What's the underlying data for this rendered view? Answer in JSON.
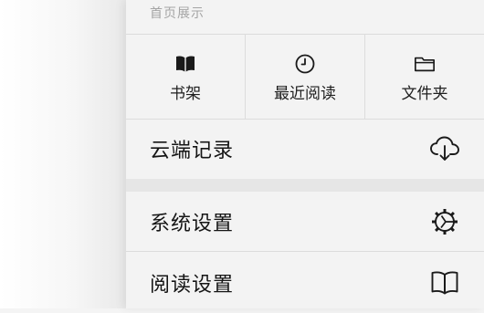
{
  "section": {
    "title": "首页展示"
  },
  "quick_access": [
    {
      "label": "书架",
      "icon": "book-filled-icon"
    },
    {
      "label": "最近阅读",
      "icon": "clock-icon"
    },
    {
      "label": "文件夹",
      "icon": "folder-icon"
    }
  ],
  "menu": {
    "cloud_label": "云端记录",
    "cloud_icon": "cloud-download-icon",
    "system_label": "系统设置",
    "system_icon": "gear-icon",
    "reading_label": "阅读设置",
    "reading_icon": "open-book-icon"
  },
  "colors": {
    "panel_bg": "#f3f3f3",
    "divider": "#dcdcdc",
    "text": "#151515",
    "muted": "#a4a4a4"
  }
}
